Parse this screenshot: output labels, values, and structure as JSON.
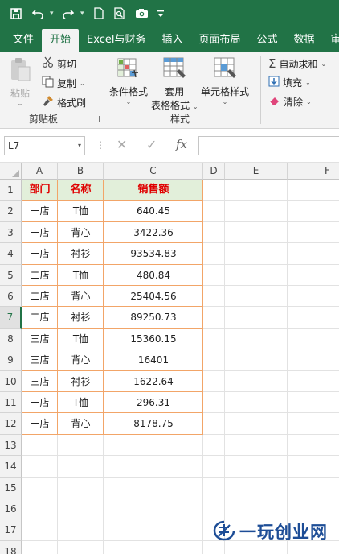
{
  "app": {
    "quick_access": [
      "save-icon",
      "undo-icon",
      "redo-icon",
      "new-file-icon",
      "print-preview-icon",
      "camera-icon",
      "customize-icon"
    ]
  },
  "tabs": [
    "文件",
    "开始",
    "Excel与财务",
    "插入",
    "页面布局",
    "公式",
    "数据",
    "审"
  ],
  "active_tab": "开始",
  "ribbon": {
    "clipboard": {
      "paste": "粘贴",
      "cut": "剪切",
      "copy": "复制",
      "format_painter": "格式刷",
      "group_label": "剪贴板"
    },
    "styles": {
      "conditional_format": "条件格式",
      "table_format_line1": "套用",
      "table_format_line2": "表格格式",
      "cell_styles": "单元格样式",
      "group_label": "样式"
    },
    "editing": {
      "autosum": "自动求和",
      "fill": "填充",
      "clear": "清除"
    }
  },
  "formula_bar": {
    "name_box": "L7",
    "fx": "fx",
    "formula": ""
  },
  "sheet": {
    "columns": [
      "A",
      "B",
      "C",
      "D",
      "E",
      "F"
    ],
    "rows": [
      "1",
      "2",
      "3",
      "4",
      "5",
      "6",
      "7",
      "8",
      "9",
      "10",
      "11",
      "12",
      "13",
      "14",
      "15",
      "16",
      "17",
      "18"
    ],
    "selected_row": "7",
    "header": [
      "部门",
      "名称",
      "销售额"
    ],
    "data": [
      [
        "一店",
        "T恤",
        "640.45"
      ],
      [
        "一店",
        "背心",
        "3422.36"
      ],
      [
        "一店",
        "衬衫",
        "93534.83"
      ],
      [
        "二店",
        "T恤",
        "480.84"
      ],
      [
        "二店",
        "背心",
        "25404.56"
      ],
      [
        "二店",
        "衬衫",
        "89250.73"
      ],
      [
        "三店",
        "T恤",
        "15360.15"
      ],
      [
        "三店",
        "背心",
        "16401"
      ],
      [
        "三店",
        "衬衫",
        "1622.64"
      ],
      [
        "一店",
        "T恤",
        "296.31"
      ],
      [
        "一店",
        "背心",
        "8178.75"
      ]
    ]
  },
  "watermark": {
    "text": "一玩创业网"
  },
  "colors": {
    "excel_green": "#217346",
    "header_text": "#e00000",
    "header_fill": "#e2efda",
    "table_border": "#f2a568",
    "watermark": "#1d4d96"
  }
}
